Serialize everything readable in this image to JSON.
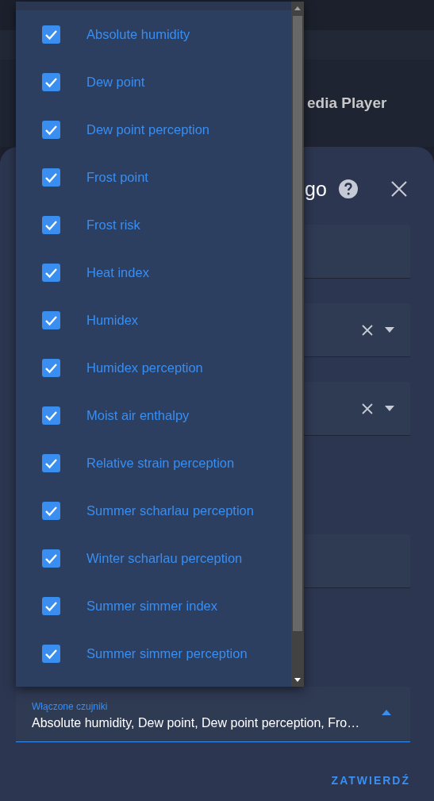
{
  "background": {
    "header_text": "edia Player"
  },
  "dialog": {
    "title": "go",
    "fields": [
      {
        "kind": "text"
      },
      {
        "kind": "select"
      },
      {
        "kind": "select"
      },
      {
        "kind": "text"
      }
    ],
    "sensors_field": {
      "label": "Włączone czujniki",
      "value": "Absolute humidity, Dew point, Dew point perception, Fro…",
      "expanded": true
    },
    "confirm_button": "ZATWIERDŹ"
  },
  "dropdown": {
    "options": [
      {
        "label": "Absolute humidity",
        "checked": true
      },
      {
        "label": "Dew point",
        "checked": true
      },
      {
        "label": "Dew point perception",
        "checked": true
      },
      {
        "label": "Frost point",
        "checked": true
      },
      {
        "label": "Frost risk",
        "checked": true
      },
      {
        "label": "Heat index",
        "checked": true
      },
      {
        "label": "Humidex",
        "checked": true
      },
      {
        "label": "Humidex perception",
        "checked": true
      },
      {
        "label": "Moist air enthalpy",
        "checked": true
      },
      {
        "label": "Relative strain perception",
        "checked": true
      },
      {
        "label": "Summer scharlau perception",
        "checked": true
      },
      {
        "label": "Winter scharlau perception",
        "checked": true
      },
      {
        "label": "Summer simmer index",
        "checked": true
      },
      {
        "label": "Summer simmer perception",
        "checked": true
      }
    ]
  }
}
